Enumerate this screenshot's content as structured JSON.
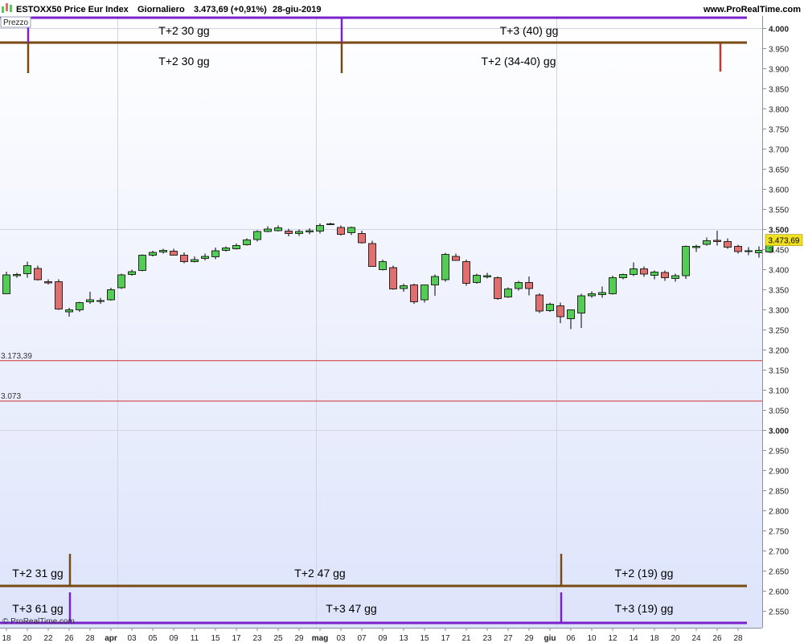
{
  "header": {
    "instrument": "ESTOXX50 Price Eur Index",
    "period": "Giornaliero",
    "quote": "3.473,69 (+0,91%)",
    "date": "28-giu-2019",
    "site": "www.ProRealTime.com",
    "panel_label": "Prezzo",
    "copyright": "© ProRealTime.com"
  },
  "colors": {
    "up": "#55cc55",
    "down": "#e07070",
    "cycle_brown": "#7a4a14",
    "cycle_purple": "#7a22cc",
    "support_red": "#d03030",
    "grid": "#d0d4e4",
    "price_badge": "#f0e020"
  },
  "chart_data": {
    "type": "candlestick",
    "ylim": [
      2515,
      4015
    ],
    "y_ticks": [
      2550,
      2600,
      2650,
      2700,
      2750,
      2800,
      2850,
      2900,
      2950,
      3000,
      3050,
      3100,
      3150,
      3200,
      3250,
      3300,
      3350,
      3400,
      3450,
      3500,
      3550,
      3600,
      3650,
      3700,
      3750,
      3800,
      3850,
      3900,
      3950,
      4000
    ],
    "y_tick_labels": [
      "2.550",
      "2.600",
      "2.650",
      "2.700",
      "2.750",
      "2.800",
      "2.850",
      "2.900",
      "2.950",
      "3.000",
      "3.050",
      "3.100",
      "3.150",
      "3.200",
      "3.250",
      "3.300",
      "3.350",
      "3.400",
      "3.450",
      "3.500",
      "3.550",
      "3.600",
      "3.650",
      "3.700",
      "3.750",
      "3.800",
      "3.850",
      "3.900",
      "3.950",
      "4.000"
    ],
    "y_bold_ticks": [
      3000,
      3500,
      4000
    ],
    "x_labels": [
      "18",
      "20",
      "22",
      "26",
      "28",
      "apr",
      "03",
      "05",
      "09",
      "11",
      "15",
      "17",
      "23",
      "25",
      "29",
      "mag",
      "03",
      "07",
      "09",
      "13",
      "15",
      "17",
      "21",
      "23",
      "27",
      "29",
      "giu",
      "06",
      "10",
      "12",
      "14",
      "18",
      "20",
      "24",
      "26",
      "28"
    ],
    "x_label_index": [
      0,
      2,
      4,
      6,
      8,
      10,
      12,
      14,
      16,
      18,
      20,
      22,
      24,
      26,
      28,
      30,
      32,
      34,
      36,
      38,
      40,
      42,
      44,
      46,
      48,
      50,
      52,
      54,
      56,
      58,
      60,
      62,
      64,
      66,
      68,
      70
    ],
    "x_bold_labels": [
      "apr",
      "mag",
      "giu"
    ],
    "month_divider_index": [
      11,
      30,
      53
    ],
    "candles": [
      {
        "o": 3340,
        "h": 3395,
        "l": 3340,
        "c": 3387
      },
      {
        "o": 3385,
        "h": 3392,
        "l": 3380,
        "c": 3388
      },
      {
        "o": 3390,
        "h": 3420,
        "l": 3380,
        "c": 3410
      },
      {
        "o": 3403,
        "h": 3410,
        "l": 3373,
        "c": 3375
      },
      {
        "o": 3370,
        "h": 3376,
        "l": 3363,
        "c": 3367
      },
      {
        "o": 3370,
        "h": 3376,
        "l": 3300,
        "c": 3302
      },
      {
        "o": 3295,
        "h": 3305,
        "l": 3283,
        "c": 3300
      },
      {
        "o": 3300,
        "h": 3320,
        "l": 3295,
        "c": 3318
      },
      {
        "o": 3320,
        "h": 3345,
        "l": 3315,
        "c": 3325
      },
      {
        "o": 3322,
        "h": 3330,
        "l": 3315,
        "c": 3323
      },
      {
        "o": 3325,
        "h": 3355,
        "l": 3323,
        "c": 3350
      },
      {
        "o": 3355,
        "h": 3390,
        "l": 3352,
        "c": 3387
      },
      {
        "o": 3388,
        "h": 3400,
        "l": 3385,
        "c": 3395
      },
      {
        "o": 3398,
        "h": 3438,
        "l": 3396,
        "c": 3436
      },
      {
        "o": 3436,
        "h": 3447,
        "l": 3433,
        "c": 3443
      },
      {
        "o": 3444,
        "h": 3452,
        "l": 3440,
        "c": 3448
      },
      {
        "o": 3446,
        "h": 3452,
        "l": 3436,
        "c": 3436
      },
      {
        "o": 3436,
        "h": 3443,
        "l": 3416,
        "c": 3420
      },
      {
        "o": 3420,
        "h": 3433,
        "l": 3418,
        "c": 3425
      },
      {
        "o": 3428,
        "h": 3440,
        "l": 3423,
        "c": 3433
      },
      {
        "o": 3432,
        "h": 3455,
        "l": 3426,
        "c": 3447
      },
      {
        "o": 3448,
        "h": 3458,
        "l": 3445,
        "c": 3454
      },
      {
        "o": 3452,
        "h": 3465,
        "l": 3450,
        "c": 3460
      },
      {
        "o": 3462,
        "h": 3478,
        "l": 3460,
        "c": 3474
      },
      {
        "o": 3475,
        "h": 3498,
        "l": 3470,
        "c": 3495
      },
      {
        "o": 3495,
        "h": 3508,
        "l": 3493,
        "c": 3501
      },
      {
        "o": 3497,
        "h": 3510,
        "l": 3495,
        "c": 3504
      },
      {
        "o": 3496,
        "h": 3502,
        "l": 3483,
        "c": 3490
      },
      {
        "o": 3490,
        "h": 3500,
        "l": 3484,
        "c": 3495
      },
      {
        "o": 3494,
        "h": 3503,
        "l": 3488,
        "c": 3497
      },
      {
        "o": 3496,
        "h": 3515,
        "l": 3490,
        "c": 3510
      },
      {
        "o": 3514,
        "h": 3517,
        "l": 3511,
        "c": 3514
      },
      {
        "o": 3505,
        "h": 3510,
        "l": 3485,
        "c": 3488
      },
      {
        "o": 3492,
        "h": 3507,
        "l": 3486,
        "c": 3505
      },
      {
        "o": 3490,
        "h": 3497,
        "l": 3465,
        "c": 3467
      },
      {
        "o": 3465,
        "h": 3472,
        "l": 3425,
        "c": 3408
      },
      {
        "o": 3400,
        "h": 3425,
        "l": 3398,
        "c": 3420
      },
      {
        "o": 3405,
        "h": 3410,
        "l": 3350,
        "c": 3352
      },
      {
        "o": 3353,
        "h": 3365,
        "l": 3345,
        "c": 3360
      },
      {
        "o": 3362,
        "h": 3365,
        "l": 3315,
        "c": 3320
      },
      {
        "o": 3325,
        "h": 3362,
        "l": 3318,
        "c": 3362
      },
      {
        "o": 3362,
        "h": 3388,
        "l": 3335,
        "c": 3383
      },
      {
        "o": 3375,
        "h": 3442,
        "l": 3370,
        "c": 3438
      },
      {
        "o": 3433,
        "h": 3440,
        "l": 3423,
        "c": 3423
      },
      {
        "o": 3420,
        "h": 3425,
        "l": 3360,
        "c": 3366
      },
      {
        "o": 3368,
        "h": 3390,
        "l": 3365,
        "c": 3386
      },
      {
        "o": 3382,
        "h": 3392,
        "l": 3378,
        "c": 3385
      },
      {
        "o": 3380,
        "h": 3383,
        "l": 3325,
        "c": 3328
      },
      {
        "o": 3332,
        "h": 3356,
        "l": 3330,
        "c": 3352
      },
      {
        "o": 3353,
        "h": 3372,
        "l": 3348,
        "c": 3368
      },
      {
        "o": 3368,
        "h": 3383,
        "l": 3336,
        "c": 3353
      },
      {
        "o": 3337,
        "h": 3341,
        "l": 3292,
        "c": 3297
      },
      {
        "o": 3298,
        "h": 3318,
        "l": 3295,
        "c": 3314
      },
      {
        "o": 3310,
        "h": 3318,
        "l": 3267,
        "c": 3283
      },
      {
        "o": 3278,
        "h": 3300,
        "l": 3252,
        "c": 3300
      },
      {
        "o": 3292,
        "h": 3340,
        "l": 3255,
        "c": 3335
      },
      {
        "o": 3335,
        "h": 3346,
        "l": 3330,
        "c": 3340
      },
      {
        "o": 3338,
        "h": 3358,
        "l": 3330,
        "c": 3343
      },
      {
        "o": 3340,
        "h": 3385,
        "l": 3338,
        "c": 3380
      },
      {
        "o": 3380,
        "h": 3390,
        "l": 3376,
        "c": 3388
      },
      {
        "o": 3388,
        "h": 3418,
        "l": 3384,
        "c": 3402
      },
      {
        "o": 3402,
        "h": 3408,
        "l": 3382,
        "c": 3389
      },
      {
        "o": 3386,
        "h": 3398,
        "l": 3376,
        "c": 3394
      },
      {
        "o": 3393,
        "h": 3398,
        "l": 3372,
        "c": 3380
      },
      {
        "o": 3378,
        "h": 3390,
        "l": 3370,
        "c": 3385
      },
      {
        "o": 3385,
        "h": 3460,
        "l": 3377,
        "c": 3458
      },
      {
        "o": 3455,
        "h": 3462,
        "l": 3444,
        "c": 3458
      },
      {
        "o": 3463,
        "h": 3480,
        "l": 3460,
        "c": 3472
      },
      {
        "o": 3473,
        "h": 3497,
        "l": 3460,
        "c": 3470
      },
      {
        "o": 3470,
        "h": 3478,
        "l": 3452,
        "c": 3456
      },
      {
        "o": 3458,
        "h": 3462,
        "l": 3440,
        "c": 3445
      },
      {
        "o": 3447,
        "h": 3456,
        "l": 3436,
        "c": 3447
      },
      {
        "o": 3442,
        "h": 3458,
        "l": 3430,
        "c": 3448
      },
      {
        "o": 3444,
        "h": 3478,
        "l": 3442,
        "c": 3474
      }
    ],
    "last_price_label": "3.473,69",
    "last_price": 3473.69,
    "support_levels": [
      {
        "value": 3173.39,
        "label": "3.173,39"
      },
      {
        "value": 3073,
        "label": "3.073"
      }
    ],
    "top_cycles": {
      "purple_marks_index": [
        2,
        32
      ],
      "brown_marks_index": [
        2,
        32
      ],
      "red_mark_index": 68,
      "labels": [
        {
          "text": "T+2 30 gg",
          "row": "upper",
          "center_index": 17
        },
        {
          "text": "T+3 (40) gg",
          "row": "upper",
          "center_index": 50
        },
        {
          "text": "T+2 30 gg",
          "row": "lower",
          "center_index": 17
        },
        {
          "text": "T+2 (34-40) gg",
          "row": "lower",
          "center_index": 49
        }
      ]
    },
    "bottom_cycles": {
      "brown_marks_index": [
        6,
        53
      ],
      "purple_marks_index": [
        6,
        53
      ],
      "labels": [
        {
          "text": "T+2 31 gg",
          "row": "upper",
          "center_index": 3
        },
        {
          "text": "T+2 47 gg",
          "row": "upper",
          "center_index": 30
        },
        {
          "text": "T+2 (19) gg",
          "row": "upper",
          "center_index": 61
        },
        {
          "text": "T+3 61 gg",
          "row": "lower",
          "center_index": 3
        },
        {
          "text": "T+3 47 gg",
          "row": "lower",
          "center_index": 33
        },
        {
          "text": "T+3 (19) gg",
          "row": "lower",
          "center_index": 61
        }
      ]
    }
  }
}
